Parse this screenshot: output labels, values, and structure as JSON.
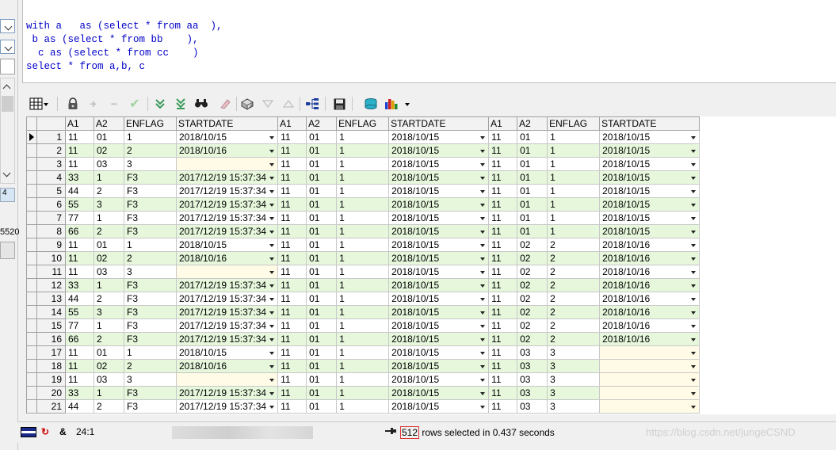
{
  "sql": {
    "lines": [
      "with a   as (select * from aa  ),",
      " b as (select * from bb    ),",
      "  c as (select * from cc    )",
      "select * from a,b, c"
    ]
  },
  "left_panel": {
    "visible_number": "5520",
    "tab_char": "4"
  },
  "toolbar": {
    "icons": [
      "grid-view-icon",
      "lock-icon",
      "plus-icon",
      "minus-icon",
      "check-icon",
      "fetch-next-icon",
      "fetch-all-icon",
      "find-icon",
      "clear-icon",
      "query-by-example-icon",
      "filter-down-icon",
      "filter-up-icon",
      "tree-icon",
      "save-icon",
      "export-icon",
      "chart-icon"
    ]
  },
  "grid": {
    "columns": [
      "A1",
      "A2",
      "ENFLAG",
      "STARTDATE",
      "A1",
      "A2",
      "ENFLAG",
      "STARTDATE",
      "A1",
      "A2",
      "ENFLAG",
      "STARTDATE"
    ],
    "current_row": 1,
    "rows": [
      [
        "1",
        "11",
        "01",
        "1",
        "2018/10/15",
        "11",
        "01",
        "1",
        "2018/10/15",
        "11",
        "01",
        "1",
        "2018/10/15"
      ],
      [
        "2",
        "11",
        "02",
        "2",
        "2018/10/16",
        "11",
        "01",
        "1",
        "2018/10/15",
        "11",
        "01",
        "1",
        "2018/10/15"
      ],
      [
        "3",
        "11",
        "03",
        "3",
        "",
        "11",
        "01",
        "1",
        "2018/10/15",
        "11",
        "01",
        "1",
        "2018/10/15"
      ],
      [
        "4",
        "33",
        "1",
        "F3",
        "2017/12/19 15:37:34",
        "11",
        "01",
        "1",
        "2018/10/15",
        "11",
        "01",
        "1",
        "2018/10/15"
      ],
      [
        "5",
        "44",
        "2",
        "F3",
        "2017/12/19 15:37:34",
        "11",
        "01",
        "1",
        "2018/10/15",
        "11",
        "01",
        "1",
        "2018/10/15"
      ],
      [
        "6",
        "55",
        "3",
        "F3",
        "2017/12/19 15:37:34",
        "11",
        "01",
        "1",
        "2018/10/15",
        "11",
        "01",
        "1",
        "2018/10/15"
      ],
      [
        "7",
        "77",
        "1",
        "F3",
        "2017/12/19 15:37:34",
        "11",
        "01",
        "1",
        "2018/10/15",
        "11",
        "01",
        "1",
        "2018/10/15"
      ],
      [
        "8",
        "66",
        "2",
        "F3",
        "2017/12/19 15:37:34",
        "11",
        "01",
        "1",
        "2018/10/15",
        "11",
        "01",
        "1",
        "2018/10/15"
      ],
      [
        "9",
        "11",
        "01",
        "1",
        "2018/10/15",
        "11",
        "01",
        "1",
        "2018/10/15",
        "11",
        "02",
        "2",
        "2018/10/16"
      ],
      [
        "10",
        "11",
        "02",
        "2",
        "2018/10/16",
        "11",
        "01",
        "1",
        "2018/10/15",
        "11",
        "02",
        "2",
        "2018/10/16"
      ],
      [
        "11",
        "11",
        "03",
        "3",
        "",
        "11",
        "01",
        "1",
        "2018/10/15",
        "11",
        "02",
        "2",
        "2018/10/16"
      ],
      [
        "12",
        "33",
        "1",
        "F3",
        "2017/12/19 15:37:34",
        "11",
        "01",
        "1",
        "2018/10/15",
        "11",
        "02",
        "2",
        "2018/10/16"
      ],
      [
        "13",
        "44",
        "2",
        "F3",
        "2017/12/19 15:37:34",
        "11",
        "01",
        "1",
        "2018/10/15",
        "11",
        "02",
        "2",
        "2018/10/16"
      ],
      [
        "14",
        "55",
        "3",
        "F3",
        "2017/12/19 15:37:34",
        "11",
        "01",
        "1",
        "2018/10/15",
        "11",
        "02",
        "2",
        "2018/10/16"
      ],
      [
        "15",
        "77",
        "1",
        "F3",
        "2017/12/19 15:37:34",
        "11",
        "01",
        "1",
        "2018/10/15",
        "11",
        "02",
        "2",
        "2018/10/16"
      ],
      [
        "16",
        "66",
        "2",
        "F3",
        "2017/12/19 15:37:34",
        "11",
        "01",
        "1",
        "2018/10/15",
        "11",
        "02",
        "2",
        "2018/10/16"
      ],
      [
        "17",
        "11",
        "01",
        "1",
        "2018/10/15",
        "11",
        "01",
        "1",
        "2018/10/15",
        "11",
        "03",
        "3",
        ""
      ],
      [
        "18",
        "11",
        "02",
        "2",
        "2018/10/16",
        "11",
        "01",
        "1",
        "2018/10/15",
        "11",
        "03",
        "3",
        ""
      ],
      [
        "19",
        "11",
        "03",
        "3",
        "",
        "11",
        "01",
        "1",
        "2018/10/15",
        "11",
        "03",
        "3",
        ""
      ],
      [
        "20",
        "33",
        "1",
        "F3",
        "2017/12/19 15:37:34",
        "11",
        "01",
        "1",
        "2018/10/15",
        "11",
        "03",
        "3",
        ""
      ],
      [
        "21",
        "44",
        "2",
        "F3",
        "2017/12/19 15:37:34",
        "11",
        "01",
        "1",
        "2018/10/15",
        "11",
        "03",
        "3",
        ""
      ]
    ]
  },
  "statusbar": {
    "cursor_pos": "24:1",
    "amp": "&",
    "rows_count": "512",
    "rows_text": " rows selected in 0.437 seconds",
    "watermark": "https://blog.csdn.net/jungeCSND"
  }
}
